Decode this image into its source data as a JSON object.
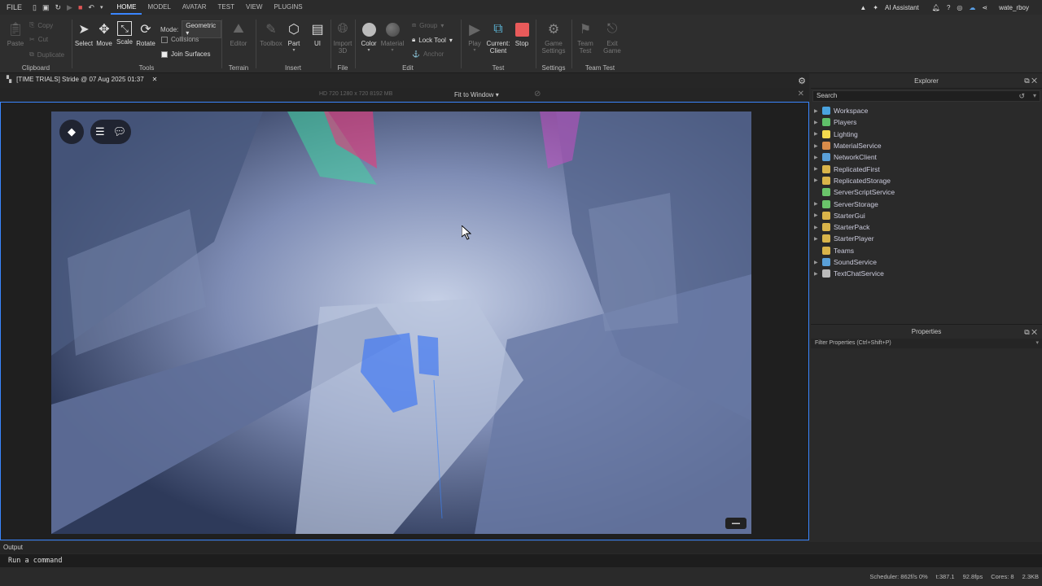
{
  "topbar": {
    "file_label": "FILE",
    "tabs": [
      "HOME",
      "MODEL",
      "AVATAR",
      "TEST",
      "VIEW",
      "PLUGINS"
    ],
    "active_tab": "HOME",
    "ai_assistant": "AI Assistant",
    "username": "wate_rboy"
  },
  "ribbon": {
    "clipboard": {
      "paste": "Paste",
      "copy": "Copy",
      "cut": "Cut",
      "duplicate": "Duplicate",
      "label": "Clipboard"
    },
    "tools": {
      "select": "Select",
      "move": "Move",
      "scale": "Scale",
      "rotate": "Rotate",
      "mode_label": "Mode:",
      "mode_value": "Geometric",
      "collisions": "Collisions",
      "join_surfaces": "Join Surfaces",
      "label": "Tools"
    },
    "terrain": {
      "editor": "Editor",
      "label": "Terrain"
    },
    "insert": {
      "toolbox": "Toolbox",
      "part": "Part",
      "ui": "UI",
      "label": "Insert"
    },
    "file": {
      "import": "Import\n3D",
      "label": "File"
    },
    "edit": {
      "color": "Color",
      "material": "Material",
      "group": "Group",
      "lock_tool": "Lock Tool",
      "anchor": "Anchor",
      "label": "Edit"
    },
    "test": {
      "play": "Play",
      "current_client_1": "Current:",
      "current_client_2": "Client",
      "stop": "Stop",
      "label": "Test"
    },
    "settings": {
      "game_settings_1": "Game",
      "game_settings_2": "Settings",
      "label": "Settings"
    },
    "team_test": {
      "team_test_1": "Team",
      "team_test_2": "Test",
      "exit_game_1": "Exit",
      "exit_game_2": "Game",
      "label": "Team Test"
    }
  },
  "document": {
    "tab_title": "[TIME TRIALS] Stride @ 07 Aug 2025 01:37"
  },
  "viewbar": {
    "resolution_info": "HD 720    1280 x 720    8192 MB",
    "fit_label": "Fit to Window"
  },
  "explorer": {
    "title": "Explorer",
    "search_placeholder": "Search",
    "items": [
      {
        "label": "Workspace",
        "color": "#4aa3df",
        "arrow": true
      },
      {
        "label": "Players",
        "color": "#5fbf6a",
        "arrow": true
      },
      {
        "label": "Lighting",
        "color": "#f2d94e",
        "arrow": true
      },
      {
        "label": "MaterialService",
        "color": "#d98c4a",
        "arrow": true
      },
      {
        "label": "NetworkClient",
        "color": "#5aa0d8",
        "arrow": true
      },
      {
        "label": "ReplicatedFirst",
        "color": "#d9b44a",
        "arrow": true
      },
      {
        "label": "ReplicatedStorage",
        "color": "#d9b44a",
        "arrow": true
      },
      {
        "label": "ServerScriptService",
        "color": "#6ac46a",
        "arrow": false
      },
      {
        "label": "ServerStorage",
        "color": "#6ac46a",
        "arrow": true
      },
      {
        "label": "StarterGui",
        "color": "#d9b44a",
        "arrow": true
      },
      {
        "label": "StarterPack",
        "color": "#d9b44a",
        "arrow": true
      },
      {
        "label": "StarterPlayer",
        "color": "#d9b44a",
        "arrow": true
      },
      {
        "label": "Teams",
        "color": "#d9b44a",
        "arrow": false
      },
      {
        "label": "SoundService",
        "color": "#5aa0d8",
        "arrow": true
      },
      {
        "label": "TextChatService",
        "color": "#bbbbbb",
        "arrow": true
      }
    ]
  },
  "properties": {
    "title": "Properties",
    "filter_placeholder": "Filter Properties (Ctrl+Shift+P)"
  },
  "output": {
    "tab_label": "Output",
    "command_placeholder": "Run a command"
  },
  "statusbar": {
    "scheduler": "Scheduler: 862f/s 0%",
    "t": "t:387.1",
    "fps": "92.8fps",
    "cores": "Cores: 8",
    "mem": "2.3KB"
  }
}
